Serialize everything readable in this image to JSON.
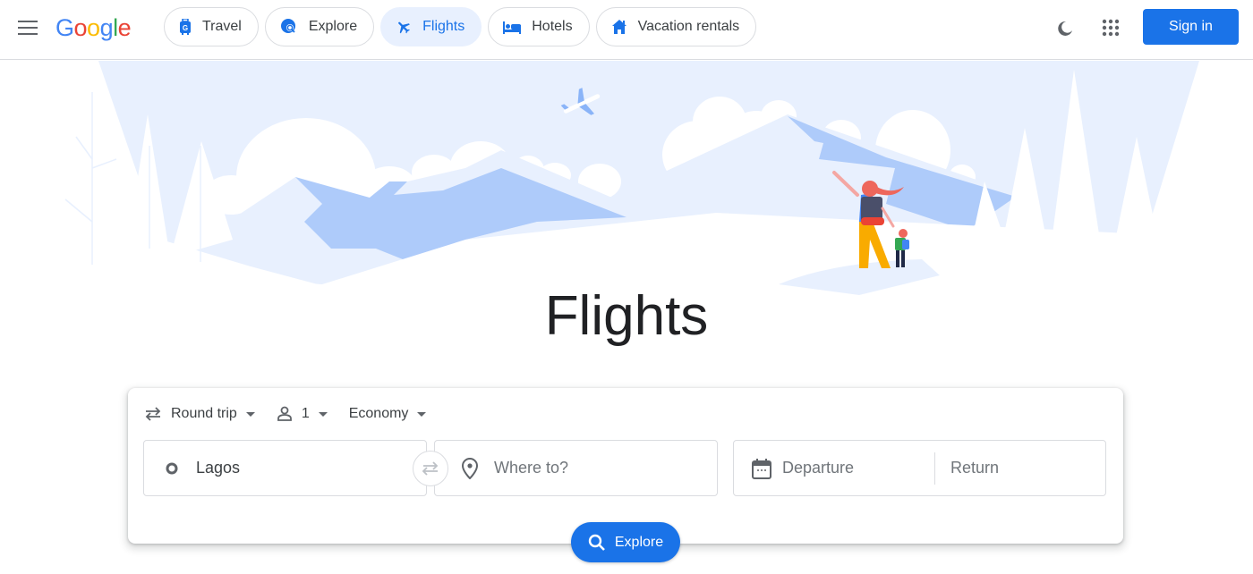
{
  "header": {
    "logo_text": "Google",
    "logo_colors": [
      "#4285f4",
      "#ea4335",
      "#fbbc05",
      "#4285f4",
      "#34a853",
      "#ea4335"
    ],
    "nav": [
      {
        "label": "Travel",
        "icon": "luggage-icon",
        "active": false
      },
      {
        "label": "Explore",
        "icon": "explore-globe-icon",
        "active": false
      },
      {
        "label": "Flights",
        "icon": "airplane-icon",
        "active": true
      },
      {
        "label": "Hotels",
        "icon": "bed-icon",
        "active": false
      },
      {
        "label": "Vacation rentals",
        "icon": "house-icon",
        "active": false
      }
    ],
    "theme_icon": "moon-icon",
    "apps_icon": "apps-grid-icon",
    "sign_in_label": "Sign in"
  },
  "colors": {
    "accent": "#1a73e8",
    "accent_light": "#e8f0fe",
    "sky": "#e8f0fe",
    "mountain": "#aecbfa"
  },
  "hero": {
    "title": "Flights"
  },
  "search": {
    "trip_type": "Round trip",
    "passengers": "1",
    "cabin_class": "Economy",
    "origin_value": "Lagos",
    "destination_placeholder": "Where to?",
    "departure_placeholder": "Departure",
    "return_placeholder": "Return",
    "explore_label": "Explore"
  }
}
